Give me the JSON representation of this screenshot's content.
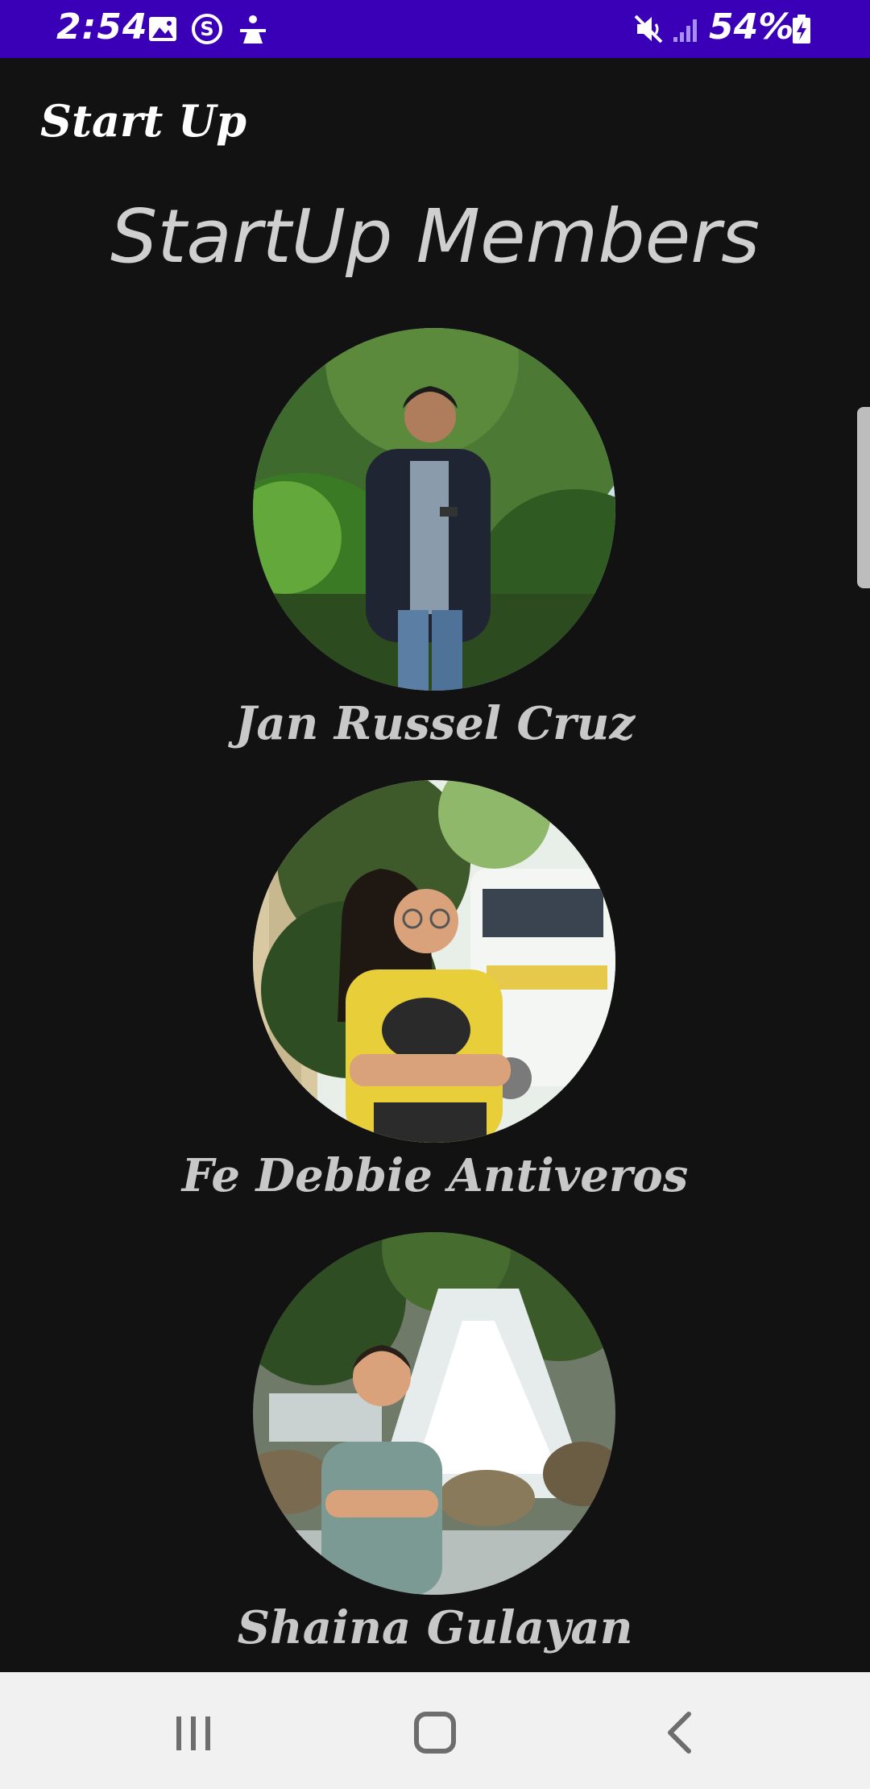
{
  "status_bar": {
    "time": "2:54",
    "battery": "54%",
    "icons": [
      "gallery-icon",
      "s-app-icon",
      "accessibility-icon",
      "mute-icon",
      "signal-icon",
      "battery-icon"
    ],
    "background": "#3a00b8"
  },
  "app": {
    "title": "Start Up"
  },
  "page": {
    "heading": "StartUp Members"
  },
  "members": [
    {
      "name": "Jan Russel Cruz",
      "photo": "member-photo-forest"
    },
    {
      "name": "Fe Debbie Antiveros",
      "photo": "member-photo-bus"
    },
    {
      "name": "Shaina Gulayan",
      "photo": "member-photo-waterfall"
    }
  ],
  "nav_bar": {
    "buttons": [
      "recent-apps-icon",
      "home-icon",
      "back-icon"
    ]
  }
}
